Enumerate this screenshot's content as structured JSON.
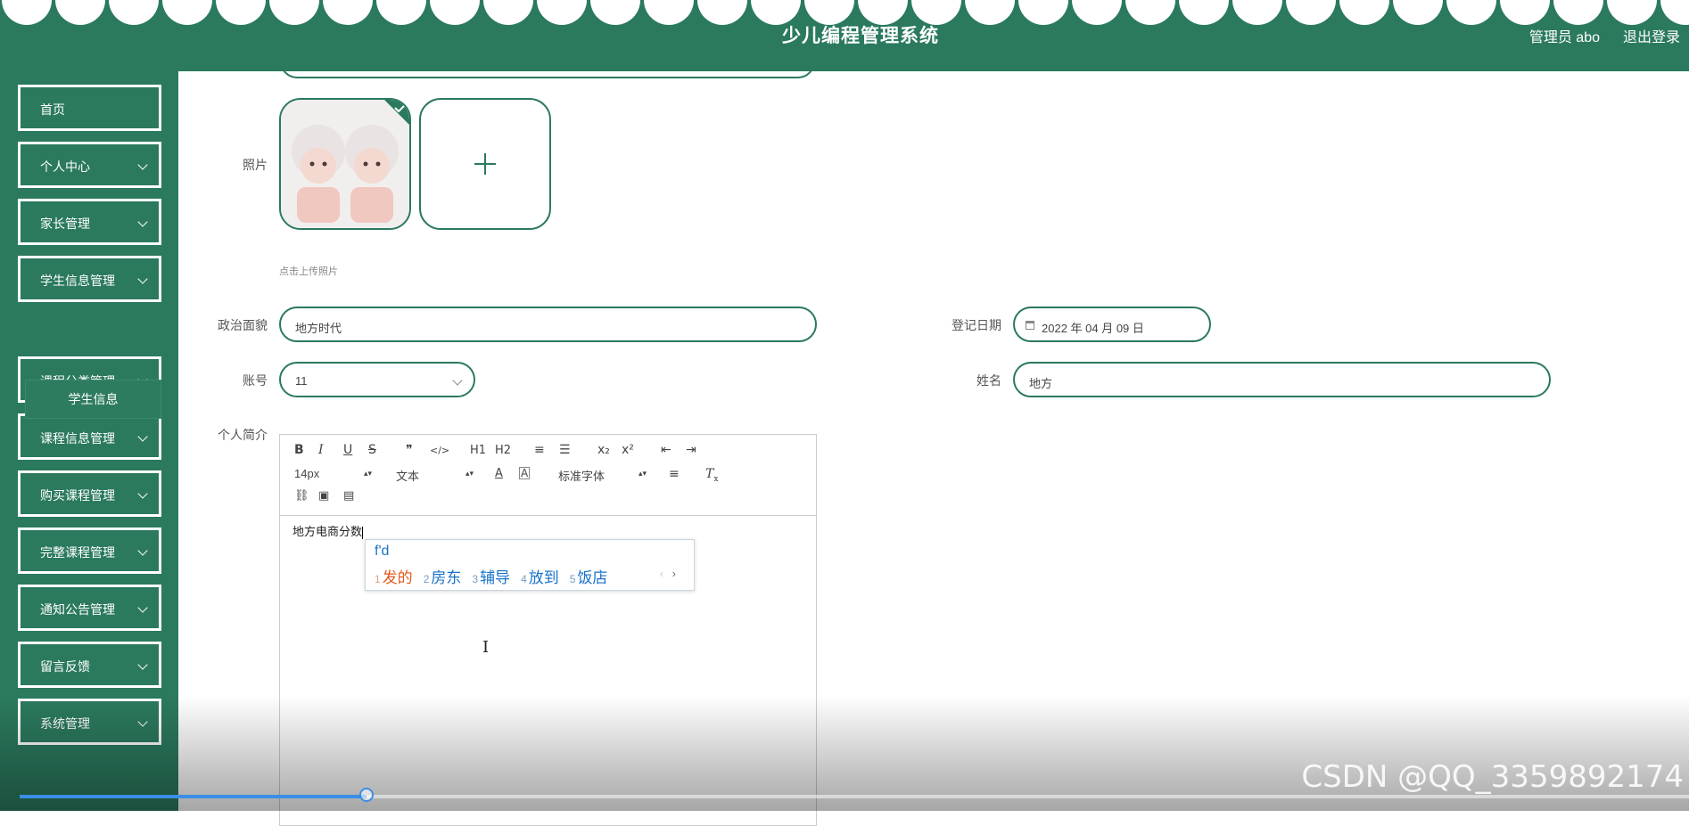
{
  "header": {
    "title": "少儿编程管理系统",
    "user": "管理员 abo",
    "logout": "退出登录"
  },
  "sidebar": {
    "items": [
      {
        "label": "首页",
        "has_chevron": false
      },
      {
        "label": "个人中心",
        "has_chevron": true
      },
      {
        "label": "家长管理",
        "has_chevron": true
      },
      {
        "label": "学生信息管理",
        "has_chevron": true
      },
      {
        "label": "课程分类管理",
        "has_chevron": true
      },
      {
        "label": "课程信息管理",
        "has_chevron": true
      },
      {
        "label": "购买课程管理",
        "has_chevron": true
      },
      {
        "label": "完整课程管理",
        "has_chevron": true
      },
      {
        "label": "通知公告管理",
        "has_chevron": true
      },
      {
        "label": "留言反馈",
        "has_chevron": true
      },
      {
        "label": "系统管理",
        "has_chevron": true
      }
    ],
    "subitem": "学生信息"
  },
  "form": {
    "photo_label": "照片",
    "upload_tip": "点击上传照片",
    "political_label": "政治面貌",
    "political_value": "地方时代",
    "date_label": "登记日期",
    "date_value": "2022 年 04 月 09 日",
    "account_label": "账号",
    "account_value": "11",
    "name_label": "姓名",
    "name_value": "地方",
    "intro_label": "个人简介"
  },
  "editor": {
    "row1": [
      "B",
      "I",
      "U",
      "S",
      "❞",
      "</>",
      "H1",
      "H2",
      "≡",
      "☰",
      "x₂",
      "x²",
      "⇤",
      "⇥"
    ],
    "size": "14px",
    "block": "文本",
    "font": "标准字体",
    "content": "地方电商分数"
  },
  "ime": {
    "input": "f'd",
    "candidates": [
      {
        "n": "1",
        "text": "发的"
      },
      {
        "n": "2",
        "text": "房东"
      },
      {
        "n": "3",
        "text": "辅导"
      },
      {
        "n": "4",
        "text": "放到"
      },
      {
        "n": "5",
        "text": "饭店"
      }
    ],
    "prev": "‹",
    "next": "›"
  },
  "video": {
    "progress": 0.208,
    "watermark": "CSDN @QQ_3359892174"
  },
  "colors": {
    "primary": "#2b7a5e",
    "accent_blue": "#3a8ee6"
  }
}
